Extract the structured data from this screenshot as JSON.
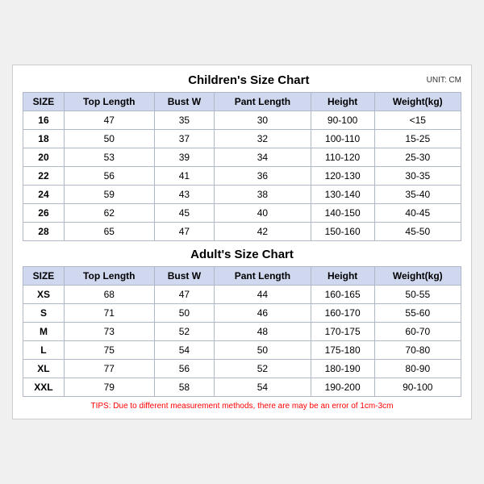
{
  "title_children": "Children's Size Chart",
  "title_adults": "Adult's Size Chart",
  "unit": "UNIT: CM",
  "headers": [
    "SIZE",
    "Top Length",
    "Bust W",
    "Pant Length",
    "Height",
    "Weight(kg)"
  ],
  "children_rows": [
    [
      "16",
      "47",
      "35",
      "30",
      "90-100",
      "<15"
    ],
    [
      "18",
      "50",
      "37",
      "32",
      "100-110",
      "15-25"
    ],
    [
      "20",
      "53",
      "39",
      "34",
      "110-120",
      "25-30"
    ],
    [
      "22",
      "56",
      "41",
      "36",
      "120-130",
      "30-35"
    ],
    [
      "24",
      "59",
      "43",
      "38",
      "130-140",
      "35-40"
    ],
    [
      "26",
      "62",
      "45",
      "40",
      "140-150",
      "40-45"
    ],
    [
      "28",
      "65",
      "47",
      "42",
      "150-160",
      "45-50"
    ]
  ],
  "adult_rows": [
    [
      "XS",
      "68",
      "47",
      "44",
      "160-165",
      "50-55"
    ],
    [
      "S",
      "71",
      "50",
      "46",
      "160-170",
      "55-60"
    ],
    [
      "M",
      "73",
      "52",
      "48",
      "170-175",
      "60-70"
    ],
    [
      "L",
      "75",
      "54",
      "50",
      "175-180",
      "70-80"
    ],
    [
      "XL",
      "77",
      "56",
      "52",
      "180-190",
      "80-90"
    ],
    [
      "XXL",
      "79",
      "58",
      "54",
      "190-200",
      "90-100"
    ]
  ],
  "tips": "TIPS: Due to different measurement methods, there are may be an error of 1cm-3cm"
}
